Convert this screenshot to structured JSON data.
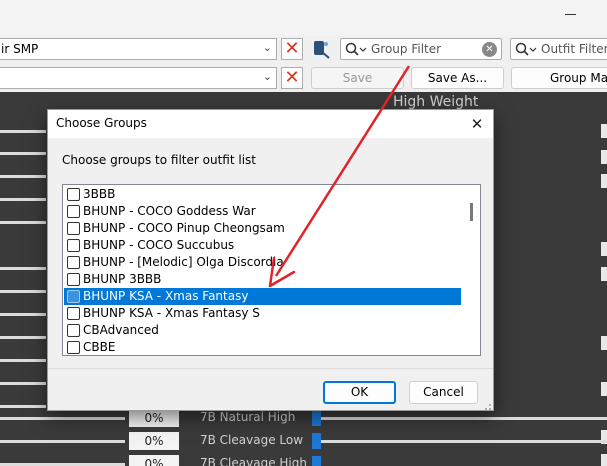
{
  "top": {
    "preset_combo_value": "ir SMP",
    "save_label": "Save",
    "save_as_label": "Save As...",
    "group_manage_label": "Group Ma",
    "group_filter_placeholder": "Group Filter",
    "outfit_filter_placeholder": "Outfit Filter",
    "high_weight_label": "High Weight"
  },
  "sliders": [
    {
      "pct": "0%",
      "label": "7B Natural High"
    },
    {
      "pct": "0%",
      "label": "7B Cleavage Low"
    },
    {
      "pct": "0%",
      "label": "7B Cleavage High"
    }
  ],
  "dialog": {
    "title": "Choose Groups",
    "prompt": "Choose groups to filter outfit list",
    "items": [
      {
        "label": "3BBB",
        "checked": false,
        "selected": false
      },
      {
        "label": "BHUNP - COCO Goddess War",
        "checked": false,
        "selected": false
      },
      {
        "label": "BHUNP - COCO Pinup Cheongsam",
        "checked": false,
        "selected": false
      },
      {
        "label": "BHUNP - COCO Succubus",
        "checked": false,
        "selected": false
      },
      {
        "label": "BHUNP - [Melodic] Olga Discordia",
        "checked": false,
        "selected": false
      },
      {
        "label": "BHUNP 3BBB",
        "checked": false,
        "selected": false
      },
      {
        "label": "BHUNP KSA - Xmas Fantasy",
        "checked": false,
        "selected": true
      },
      {
        "label": "BHUNP KSA - Xmas Fantasy S",
        "checked": false,
        "selected": false
      },
      {
        "label": "CBAdvanced",
        "checked": false,
        "selected": false
      },
      {
        "label": "CBBE",
        "checked": false,
        "selected": false
      }
    ],
    "ok_label": "OK",
    "cancel_label": "Cancel"
  },
  "colors": {
    "accent": "#0078d7",
    "annotation_arrow": "#e0242a",
    "clear_button": "#d2381d"
  },
  "icons": {
    "close": "close-icon",
    "clear": "x-icon",
    "search": "search-icon",
    "dropdown": "chevron-down-icon",
    "tool": "brush-icon"
  }
}
